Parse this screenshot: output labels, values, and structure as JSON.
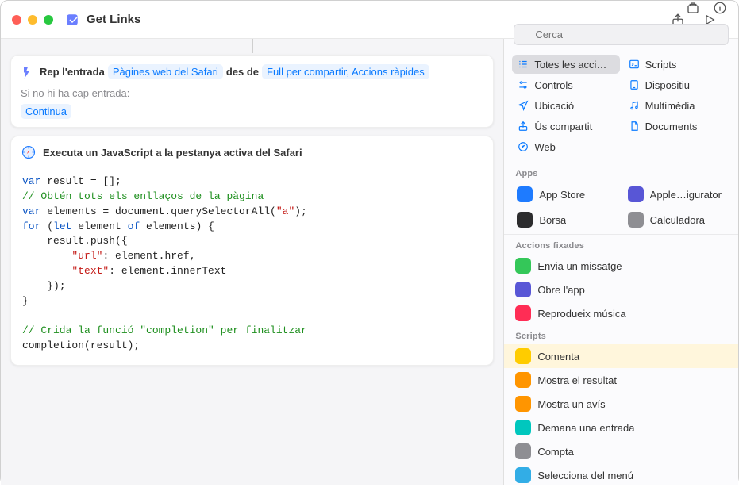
{
  "window": {
    "title": "Get Links"
  },
  "sidebar": {
    "search_placeholder": "Cerca",
    "categories": [
      {
        "label": "Totes les acci…",
        "icon": "list",
        "selected": true
      },
      {
        "label": "Scripts",
        "icon": "terminal"
      },
      {
        "label": "Controls",
        "icon": "slider"
      },
      {
        "label": "Dispositiu",
        "icon": "device"
      },
      {
        "label": "Ubicació",
        "icon": "location"
      },
      {
        "label": "Multimèdia",
        "icon": "music"
      },
      {
        "label": "Ús compartit",
        "icon": "share"
      },
      {
        "label": "Documents",
        "icon": "document"
      },
      {
        "label": "Web",
        "icon": "safari"
      }
    ],
    "apps_header": "Apps",
    "apps": [
      {
        "label": "App Store",
        "color": "bg-blue"
      },
      {
        "label": "Apple…igurator",
        "color": "bg-purple"
      },
      {
        "label": "Borsa",
        "color": "bg-dark"
      },
      {
        "label": "Calculadora",
        "color": "bg-gray"
      }
    ],
    "pinned_header": "Accions fixades",
    "pinned": [
      {
        "label": "Envia un missatge",
        "color": "bg-green"
      },
      {
        "label": "Obre l'app",
        "color": "bg-purple"
      },
      {
        "label": "Reprodueix música",
        "color": "bg-red"
      }
    ],
    "scripts_header": "Scripts",
    "scripts": [
      {
        "label": "Comenta",
        "color": "bg-yellow",
        "selected": true
      },
      {
        "label": "Mostra el resultat",
        "color": "bg-orange"
      },
      {
        "label": "Mostra un avís",
        "color": "bg-orange"
      },
      {
        "label": "Demana una entrada",
        "color": "bg-teal"
      },
      {
        "label": "Compta",
        "color": "bg-gray"
      },
      {
        "label": "Selecciona del menú",
        "color": "bg-cyan"
      }
    ]
  },
  "workflow": {
    "input": {
      "receives": "Rep l'entrada",
      "source_chip": "Pàgines web del Safari",
      "from": "des de",
      "destinations_chip": "Full per compartir, Accions ràpides",
      "no_input_label": "Si no hi ha cap entrada:",
      "continue_chip": "Continua"
    },
    "jsaction": {
      "title": "Executa un JavaScript a la pestanya activa del Safari",
      "code_plain": "var result = [];\n// Obtén tots els enllaços de la pàgina\nvar elements = document.querySelectorAll(\"a\");\nfor (let element of elements) {\n    result.push({\n        \"url\": element.href,\n        \"text\": element.innerText\n    });\n}\n\n// Crida la funció \"completion\" per finalitzar\ncompletion(result);"
    }
  }
}
